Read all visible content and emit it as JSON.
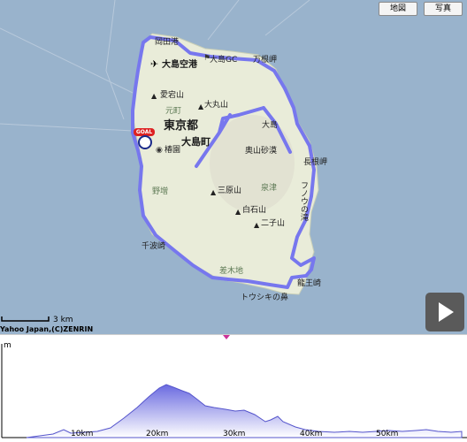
{
  "map": {
    "buttons": {
      "map": "地図",
      "photo": "写真"
    },
    "labels": {
      "okata": "岡田港",
      "airport": "大島空港",
      "golf": "大島GC",
      "manteisaki": "万根岬",
      "atagoyama": "愛宕山",
      "motomachi": "元町",
      "omaruyama": "大丸山",
      "oshima_north": "大島",
      "tokyo": "東京都",
      "oshima_town": "大島町",
      "tsubaki": "椿園",
      "okuyama_sabaku": "奥山砂漠",
      "nagane": "長根岬",
      "nomashi": "野増",
      "mihara": "三原山",
      "izumitsu": "泉津",
      "fuganotaki": "フノウの滝",
      "shiraishi": "白石山",
      "futagoyama": "二子山",
      "senzu": "千波崎",
      "sashikiji": "差木地",
      "habu": "龍王崎",
      "toushiki": "トウシキの鼻"
    },
    "goal_badge": "GOAL",
    "scale": "3 km",
    "copyright": "Yahoo Japan,(C)ZENRIN",
    "colors": {
      "sea": "#99b3cc",
      "land": "#e9ecd9",
      "route": "#7777ee"
    }
  },
  "elevation": {
    "unit": "m",
    "ticks": [
      "10km",
      "20km",
      "30km",
      "40km",
      "50km"
    ],
    "colors": {
      "fill_top": "#6a6ae0",
      "fill_bottom": "#ffffff",
      "line": "#5555cc"
    }
  },
  "icons": {
    "play": "play-icon",
    "airport": "airplane-icon",
    "golf": "flag-icon",
    "goal": "goal-marker-icon"
  }
}
